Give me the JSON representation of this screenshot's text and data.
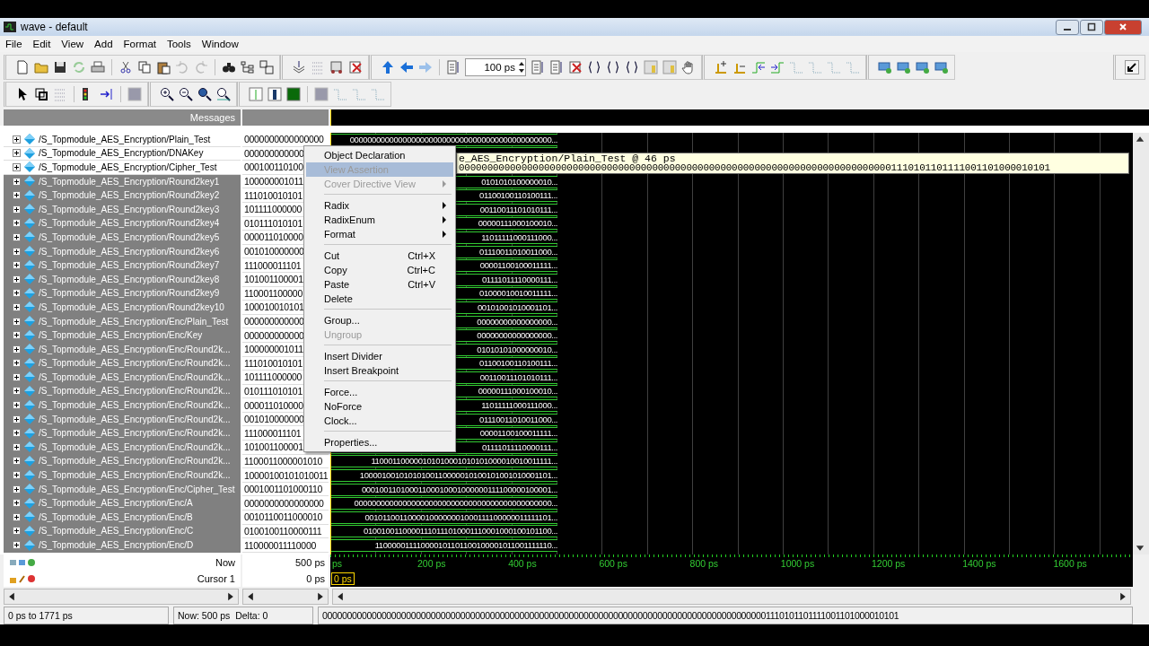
{
  "window": {
    "title": "wave - default"
  },
  "menu": [
    "File",
    "Edit",
    "View",
    "Add",
    "Format",
    "Tools",
    "Window"
  ],
  "toolbar": {
    "time_step": "100 ps"
  },
  "pane_header": {
    "messages": "Messages"
  },
  "signals": [
    {
      "name": "/S_Topmodule_AES_Encryption/Plain_Test",
      "value": "0000000000000000",
      "wave": "0000000000000000000000000000000000000000000000...",
      "selected": false
    },
    {
      "name": "/S_Topmodule_AES_Encryption/DNAKey",
      "value": "000000000000",
      "selected": false
    },
    {
      "name": "/S_Topmodule_AES_Encryption/Cipher_Test",
      "value": "000100110100",
      "selected": false
    },
    {
      "name": "/S_Topmodule_AES_Encryption/Round2key1",
      "value": "100000001011",
      "wave": "0101010100000010...",
      "selected": true
    },
    {
      "name": "/S_Topmodule_AES_Encryption/Round2key2",
      "value": "111010010101",
      "wave": "01100100110100111...",
      "selected": true
    },
    {
      "name": "/S_Topmodule_AES_Encryption/Round2key3",
      "value": "101111000000",
      "wave": "00110011101010111...",
      "selected": true
    },
    {
      "name": "/S_Topmodule_AES_Encryption/Round2key4",
      "value": "010111010101",
      "wave": "00000111000100010...",
      "selected": true
    },
    {
      "name": "/S_Topmodule_AES_Encryption/Round2key5",
      "value": "000011010000",
      "wave": "11011111000111000...",
      "selected": true
    },
    {
      "name": "/S_Topmodule_AES_Encryption/Round2key6",
      "value": "001010000000",
      "wave": "01110011010011000...",
      "selected": true
    },
    {
      "name": "/S_Topmodule_AES_Encryption/Round2key7",
      "value": "111000011101",
      "wave": "00001100100011111...",
      "selected": true
    },
    {
      "name": "/S_Topmodule_AES_Encryption/Round2key8",
      "value": "101001100001",
      "wave": "01111011110000111...",
      "selected": true
    },
    {
      "name": "/S_Topmodule_AES_Encryption/Round2key9",
      "value": "110001100000",
      "wave": "01000010010011111...",
      "selected": true
    },
    {
      "name": "/S_Topmodule_AES_Encryption/Round2key10",
      "value": "100010010101",
      "wave": "00101001010001101...",
      "selected": true
    },
    {
      "name": "/S_Topmodule_AES_Encryption/Enc/Plain_Test",
      "value": "000000000000",
      "wave": "00000000000000000...",
      "selected": true
    },
    {
      "name": "/S_Topmodule_AES_Encryption/Enc/Key",
      "value": "000000000000",
      "wave": "00000000000000000...",
      "selected": true
    },
    {
      "name": "/S_Topmodule_AES_Encryption/Enc/Round2k...",
      "value": "100000001011",
      "wave": "01010101000000010...",
      "selected": true
    },
    {
      "name": "/S_Topmodule_AES_Encryption/Enc/Round2k...",
      "value": "111010010101",
      "wave": "01100100110100111...",
      "selected": true
    },
    {
      "name": "/S_Topmodule_AES_Encryption/Enc/Round2k...",
      "value": "101111000000",
      "wave": "00110011101010111...",
      "selected": true
    },
    {
      "name": "/S_Topmodule_AES_Encryption/Enc/Round2k...",
      "value": "010111010101",
      "wave": "00000111000100010...",
      "selected": true
    },
    {
      "name": "/S_Topmodule_AES_Encryption/Enc/Round2k...",
      "value": "000011010000",
      "wave": "11011111000111000...",
      "selected": true
    },
    {
      "name": "/S_Topmodule_AES_Encryption/Enc/Round2k...",
      "value": "001010000000",
      "wave": "01110011010011000...",
      "selected": true
    },
    {
      "name": "/S_Topmodule_AES_Encryption/Enc/Round2k...",
      "value": "111000011101",
      "wave": "00001100100011111...",
      "selected": true
    },
    {
      "name": "/S_Topmodule_AES_Encryption/Enc/Round2k...",
      "value": "101001100001",
      "wave": "01111011110000111...",
      "selected": true
    },
    {
      "name": "/S_Topmodule_AES_Encryption/Enc/Round2k...",
      "value": "1100011000001010",
      "wave": "110001100000101010001010101000010010011111...",
      "selected": true
    },
    {
      "name": "/S_Topmodule_AES_Encryption/Enc/Round2k...",
      "value": "10000100101010011",
      "wave": "10000100101010100110000010100101001010001101...",
      "selected": true
    },
    {
      "name": "/S_Topmodule_AES_Encryption/Enc/Cipher_Test",
      "value": "0001001101000110",
      "wave": "00010011010001100010001000000111100000100001...",
      "selected": true
    },
    {
      "name": "/S_Topmodule_AES_Encryption/Enc/A",
      "value": "0000000000000000",
      "wave": "000000000000000000000000000000000000000000000...",
      "selected": true
    },
    {
      "name": "/S_Topmodule_AES_Encryption/Enc/B",
      "value": "0010110011000010",
      "wave": "00101100110000100000001000111100000011111101...",
      "selected": true
    },
    {
      "name": "/S_Topmodule_AES_Encryption/Enc/C",
      "value": "0100100110000111",
      "wave": "01001001100001110111010001110001000100101100...",
      "selected": true
    },
    {
      "name": "/S_Topmodule_AES_Encryption/Enc/D",
      "value": "110000011110000",
      "wave": "110000011110000101101100100001011001111110...",
      "selected": true
    }
  ],
  "context_menu": [
    {
      "kind": "item",
      "label": "Object Declaration",
      "disabled": false,
      "submenu": false,
      "selected": false
    },
    {
      "kind": "item",
      "label": "View Assertion",
      "disabled": true,
      "submenu": false,
      "selected": true
    },
    {
      "kind": "item",
      "label": "Cover Directive View",
      "disabled": true,
      "submenu": true,
      "selected": false
    },
    {
      "kind": "separator"
    },
    {
      "kind": "item",
      "label": "Radix",
      "disabled": false,
      "submenu": true,
      "selected": false
    },
    {
      "kind": "item",
      "label": "RadixEnum",
      "disabled": false,
      "submenu": true,
      "selected": false
    },
    {
      "kind": "item",
      "label": "Format",
      "disabled": false,
      "submenu": true,
      "selected": false
    },
    {
      "kind": "separator"
    },
    {
      "kind": "item",
      "label": "Cut",
      "shortcut": "Ctrl+X",
      "disabled": false,
      "submenu": false,
      "selected": false
    },
    {
      "kind": "item",
      "label": "Copy",
      "shortcut": "Ctrl+C",
      "disabled": false,
      "submenu": false,
      "selected": false
    },
    {
      "kind": "item",
      "label": "Paste",
      "shortcut": "Ctrl+V",
      "disabled": false,
      "submenu": false,
      "selected": false
    },
    {
      "kind": "item",
      "label": "Delete",
      "disabled": false,
      "submenu": false,
      "selected": false
    },
    {
      "kind": "separator"
    },
    {
      "kind": "item",
      "label": "Group...",
      "disabled": false,
      "submenu": false,
      "selected": false
    },
    {
      "kind": "item",
      "label": "Ungroup",
      "disabled": true,
      "submenu": false,
      "selected": false
    },
    {
      "kind": "separator"
    },
    {
      "kind": "item",
      "label": "Insert Divider",
      "disabled": false,
      "submenu": false,
      "selected": false
    },
    {
      "kind": "item",
      "label": "Insert Breakpoint",
      "disabled": false,
      "submenu": false,
      "selected": false
    },
    {
      "kind": "separator"
    },
    {
      "kind": "item",
      "label": "Force...",
      "disabled": false,
      "submenu": false,
      "selected": false
    },
    {
      "kind": "item",
      "label": "NoForce",
      "disabled": false,
      "submenu": false,
      "selected": false
    },
    {
      "kind": "item",
      "label": "Clock...",
      "disabled": false,
      "submenu": false,
      "selected": false
    },
    {
      "kind": "separator"
    },
    {
      "kind": "item",
      "label": "Properties...",
      "disabled": false,
      "submenu": false,
      "selected": false
    }
  ],
  "tooltip": {
    "title": "e_AES_Encryption/Plain_Test @ 46 ps",
    "value": "00000000000000000000000000000000000000000000000000000000000000000000000000001110101101111001101000010101"
  },
  "cursor_rows": [
    {
      "label": "Now",
      "value": "500 ps"
    },
    {
      "label": "Cursor 1",
      "value": "0 ps"
    }
  ],
  "timeline": {
    "ticks": [
      "ps",
      "200 ps",
      "400 ps",
      "600 ps",
      "800 ps",
      "1000 ps",
      "1200 ps",
      "1400 ps",
      "1600 ps"
    ],
    "cursor_flag": "0 ps"
  },
  "status_bar": [
    "0 ps to 1771 ps",
    "Now: 500 ps  Delta: 0",
    "0000000000000000000000000000000000000000000000000000000000000000000000000000000000000000001110101101111001101000010101"
  ]
}
